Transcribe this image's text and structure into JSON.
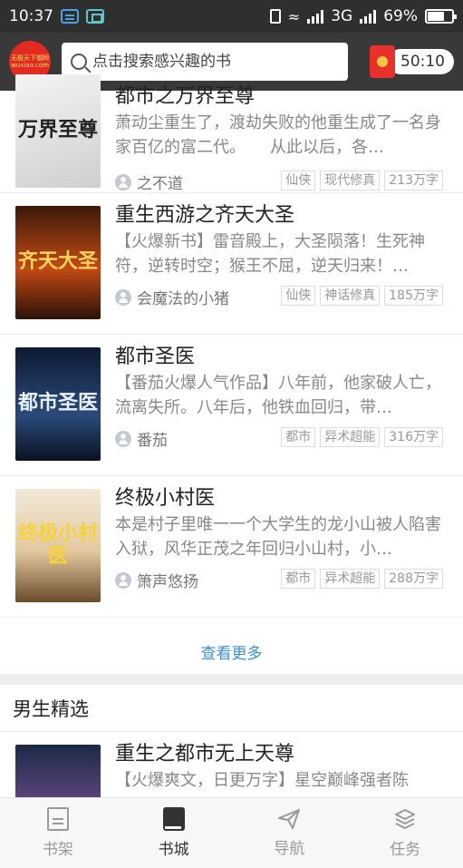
{
  "status_bar": {
    "time": "10:37",
    "network": "3G",
    "battery": "69%",
    "battery_level": 0.69
  },
  "header": {
    "logo_text": [
      "无极天下御网",
      "wuxiao.com"
    ],
    "search_placeholder": "点击搜索感兴趣的书",
    "timer": "50:10"
  },
  "books": [
    {
      "title": "都市之万界至尊",
      "desc": "萧动尘重生了，渡劫失败的他重生成了一名身家百亿的富二代。　　从此以后，各…",
      "author": "之不道",
      "tags": [
        "仙侠",
        "现代修真",
        "213万字"
      ],
      "cover_text": "万界至尊"
    },
    {
      "title": "重生西游之齐天大圣",
      "desc": "【火爆新书】雷音殿上，大圣陨落！生死神符，逆转时空；猴王不屈，逆天归来！…",
      "author": "会魔法的小猪",
      "tags": [
        "仙侠",
        "神话修真",
        "185万字"
      ],
      "cover_text": "齐天大圣"
    },
    {
      "title": "都市圣医",
      "desc": "【番茄火爆人气作品】八年前，他家破人亡，流离失所。八年后，他铁血回归，带…",
      "author": "番茄",
      "tags": [
        "都市",
        "异术超能",
        "316万字"
      ],
      "cover_text": "都市圣医"
    },
    {
      "title": "终极小村医",
      "desc": "本是村子里唯一一个大学生的龙小山被人陷害入狱，风华正茂之年回归小山村，小…",
      "author": "箫声悠扬",
      "tags": [
        "都市",
        "异术超能",
        "288万字"
      ],
      "cover_text": "终极小村医"
    }
  ],
  "more_label": "查看更多",
  "section_title": "男生精选",
  "featured": {
    "title": "重生之都市无上天尊",
    "desc": "【火爆爽文，日更万字】星空巅峰强者陈"
  },
  "tabs": [
    {
      "label": "书架",
      "icon": "bookshelf-icon"
    },
    {
      "label": "书城",
      "icon": "book-icon"
    },
    {
      "label": "导航",
      "icon": "paper-plane-icon"
    },
    {
      "label": "任务",
      "icon": "layers-icon"
    }
  ],
  "colors": {
    "header_bg": "#393939",
    "status_bg": "#2f2f2f",
    "link": "#3a8fd8",
    "red": "#e8312b"
  }
}
